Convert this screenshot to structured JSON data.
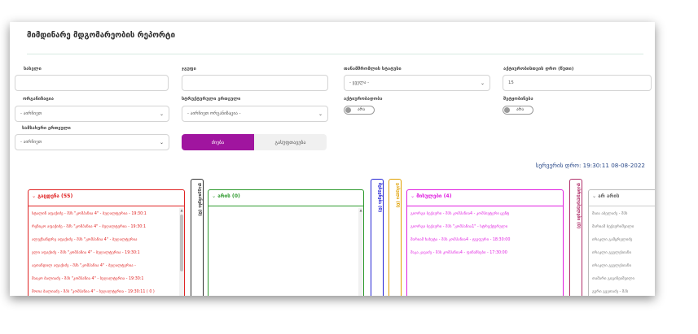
{
  "page_title": "მიმდინარე მდგომარეობის რეპორტი",
  "filters": {
    "name_label": "სახელი",
    "group_label": "ჯგუფი",
    "employee_status_label": "თანამშრომლის სტატუსი",
    "employee_status_value": "- ყველა -",
    "time_label": "აქტიურობისთვის დრო (წუთი)",
    "time_value": "15",
    "org_label": "ორგანიზაცია",
    "org_value": "- აირჩიეთ",
    "structural_unit_label": "სტრუქტურული ერთეული",
    "structural_unit_value": "- აირჩიეთ ორგანიზაცია -",
    "activity_label": "აქტიურობადობა",
    "activity_toggle": "არა",
    "delay_label": "შეტყობინება",
    "delay_toggle": "არა",
    "territorial_unit_label": "სამსახური ერთეული",
    "territorial_unit_value": "- აირჩიეთ"
  },
  "buttons": {
    "search": "ძიება",
    "clear": "გასუფთავება"
  },
  "server_time": "სერვერის დრო: 19:30:11 08-08-2022",
  "panels": {
    "late": {
      "header": "გაცდენა (55)",
      "rows": [
        "სტალინ აფაქიძე - შპს \"კომპანია 4\" - ბუღალტერია - 19:30:1",
        "რეზიკო აფაქიძე - შპს \"კომპანია 4\" - ბუღალტერია - 19:30:1",
        "ალექსანდრე აფაქიძე - შპს \"კომპანია 4\" - ბუღალტერია",
        "ელი აფაქიძე - შპს \"კომპანია 4\" - ბუღალტერია - 19:30:1",
        "ავთანდილ აფაქიძე - შპს \"კომპანია 4\" - ბუღალტერია -",
        "მაიკო ბალიაძე - შპს \"კომპანია 4\" - ბუღალტერია - 19:30:1",
        "შოთა ბალიაძე - შპს \"კომპანია 4\" - ბუღალტერია - 19:30:11 ( 0 )"
      ]
    },
    "vertical_1": "დაგვიანება (0)",
    "present": {
      "header": "არის (0)"
    },
    "vertical_2": "შესვენება (0)",
    "vertical_3": "გასვლა (0)",
    "outside": {
      "header": "მისულები (4)",
      "rows": [
        "გიორგი ბექაური - შპს კომპანია4 - კომპიუტერი ცენტ",
        "გიორგი ბექაური - შპს \"კომპანია1\" - სტრუქტურული",
        "მარიამ ხახუტა - შპს კომპანია4 - ჯგუფური - 18:30:00",
        "მაკა კავაძე - შპს კომპანია4 - ფინანსები - 17:30:00"
      ]
    },
    "vertical_4": "დასრულებულები (0)",
    "no_data": {
      "header": "არ არის",
      "rows": [
        "მაია აბელაძე - შპს",
        "მარიამ ბექაურიშვილი",
        "ირაკლი გამყრელიძე",
        "ირაკლი გველესიანი",
        "ირაკლი გველესიანი",
        "თამარი გიგინეიშვილი",
        "გური გვეთაძე - შპს"
      ]
    }
  },
  "colors": {
    "accent": "#a0159f",
    "late": "#e02424",
    "present": "#2e9a2e",
    "break": "#2424d4",
    "exit": "#e0a000",
    "outside": "#e01fe0",
    "done": "#b0306a",
    "no_data": "#999999"
  }
}
